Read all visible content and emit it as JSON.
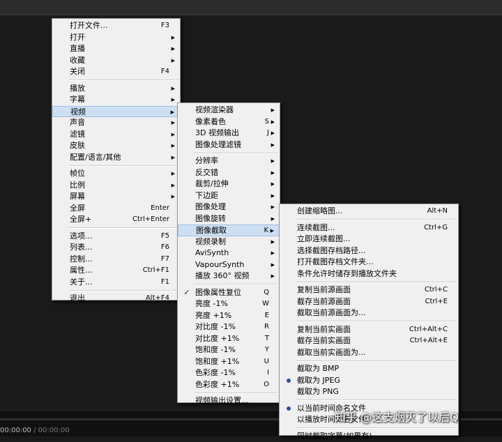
{
  "player": {
    "time_current": "00:00:00",
    "time_total": "/ 00:00:00"
  },
  "watermark": "知乎 @这支烟灭了以后Q",
  "main_menu": [
    {
      "label": "打开文件...",
      "shortcut": "F3"
    },
    {
      "label": "打开",
      "arrow": true
    },
    {
      "label": "直播",
      "arrow": true
    },
    {
      "label": "收藏",
      "arrow": true
    },
    {
      "label": "关闭",
      "shortcut": "F4"
    },
    {
      "sep": true
    },
    {
      "label": "播放",
      "arrow": true
    },
    {
      "label": "字幕",
      "arrow": true
    },
    {
      "label": "视频",
      "arrow": true,
      "highlight": true
    },
    {
      "label": "声音",
      "arrow": true
    },
    {
      "label": "滤镜",
      "arrow": true
    },
    {
      "label": "皮肤",
      "arrow": true
    },
    {
      "label": "配置/语言/其他",
      "arrow": true
    },
    {
      "sep": true
    },
    {
      "label": "帧位",
      "arrow": true
    },
    {
      "label": "比例",
      "arrow": true
    },
    {
      "label": "屏幕",
      "arrow": true
    },
    {
      "label": "全屏",
      "shortcut": "Enter"
    },
    {
      "label": "全屏+",
      "shortcut": "Ctrl+Enter"
    },
    {
      "sep": true
    },
    {
      "label": "选项...",
      "shortcut": "F5"
    },
    {
      "label": "列表...",
      "shortcut": "F6"
    },
    {
      "label": "控制...",
      "shortcut": "F7"
    },
    {
      "label": "属性...",
      "shortcut": "Ctrl+F1"
    },
    {
      "label": "关于...",
      "shortcut": "F1"
    },
    {
      "sep": true
    },
    {
      "label": "退出",
      "shortcut": "Alt+F4"
    }
  ],
  "video_menu": [
    {
      "label": "视频渲染器",
      "arrow": true
    },
    {
      "label": "像素着色",
      "shortcut": "S",
      "arrow": true
    },
    {
      "label": "3D 视频输出",
      "shortcut": "J",
      "arrow": true
    },
    {
      "label": "图像处理滤镜",
      "arrow": true
    },
    {
      "sep": true
    },
    {
      "label": "分辨率",
      "arrow": true
    },
    {
      "label": "反交错",
      "arrow": true
    },
    {
      "label": "裁剪/拉伸",
      "arrow": true
    },
    {
      "label": "下边距",
      "arrow": true
    },
    {
      "label": "图像处理",
      "arrow": true
    },
    {
      "label": "图像旋转",
      "arrow": true
    },
    {
      "label": "图像截取",
      "shortcut": "K",
      "arrow": true,
      "highlight": true
    },
    {
      "label": "视频录制",
      "arrow": true
    },
    {
      "label": "AviSynth",
      "arrow": true
    },
    {
      "label": "VapourSynth",
      "arrow": true
    },
    {
      "label": "播放 360° 视频",
      "arrow": true
    },
    {
      "sep": true
    },
    {
      "label": "图像属性复位",
      "shortcut": "Q",
      "check": true
    },
    {
      "label": "亮度 -1%",
      "shortcut": "W"
    },
    {
      "label": "亮度 +1%",
      "shortcut": "E"
    },
    {
      "label": "对比度 -1%",
      "shortcut": "R"
    },
    {
      "label": "对比度 +1%",
      "shortcut": "T"
    },
    {
      "label": "饱和度 -1%",
      "shortcut": "Y"
    },
    {
      "label": "饱和度 +1%",
      "shortcut": "U"
    },
    {
      "label": "色彩度 -1%",
      "shortcut": "I"
    },
    {
      "label": "色彩度 +1%",
      "shortcut": "O"
    },
    {
      "sep": true
    },
    {
      "label": "视频输出设置..."
    }
  ],
  "capture_menu": [
    {
      "label": "创建缩略图...",
      "shortcut": "Alt+N"
    },
    {
      "sep": true
    },
    {
      "label": "连续截图...",
      "shortcut": "Ctrl+G"
    },
    {
      "label": "立即连续截图..."
    },
    {
      "label": "选择截图存档路径..."
    },
    {
      "label": "打开截图存档文件夹..."
    },
    {
      "label": "条件允许时储存到播放文件夹"
    },
    {
      "sep": true
    },
    {
      "label": "复制当前源画面",
      "shortcut": "Ctrl+C"
    },
    {
      "label": "截存当前源画面",
      "shortcut": "Ctrl+E"
    },
    {
      "label": "截取当前源画面为..."
    },
    {
      "sep": true
    },
    {
      "label": "复制当前实画面",
      "shortcut": "Ctrl+Alt+C"
    },
    {
      "label": "截存当前实画面",
      "shortcut": "Ctrl+Alt+E"
    },
    {
      "label": "截取当前实画面为..."
    },
    {
      "sep": true
    },
    {
      "label": "截取为 BMP"
    },
    {
      "label": "截取为 JPEG",
      "radio": true
    },
    {
      "label": "截取为 PNG"
    },
    {
      "sep": true
    },
    {
      "label": "以当前时间命名文件",
      "radio": true
    },
    {
      "label": "以播放时间命名文件"
    },
    {
      "sep": true
    },
    {
      "label": "同时截取字幕(如果有)"
    }
  ]
}
